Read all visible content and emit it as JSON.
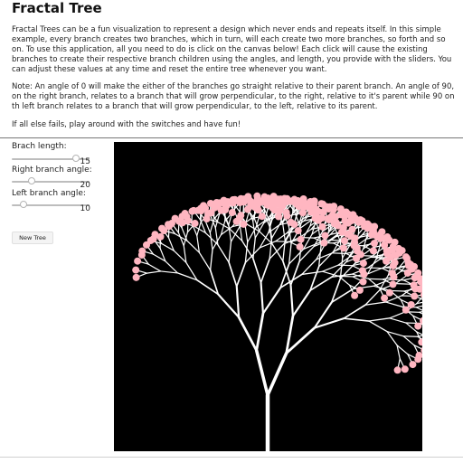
{
  "page": {
    "title": "Fractal Tree",
    "intro": "Fractal Trees can be a fun visualization to represent a design which never ends and repeats itself. In this simple example, every branch creates two branches, which in turn, will each create two more branches, so forth and so on. To use this application, all you need to do is click on the canvas below! Each click will cause the existing branches to create their respective branch children using the angles, and length, you provide with the sliders. You can adjust these values at any time and reset the entire tree whenever you want.",
    "note": "Note: An angle of 0 will make the either of the branches go straight relative to their parent branch. An angle of 90, on the right branch, relates to a branch that will grow perpendicular, to the right, relative to it's parent while 90 on th left branch relates to a branch that will grow perpendicular, to the left, relative to its parent.",
    "tip": "If all else fails, play around with the switches and have fun!"
  },
  "controls": {
    "branch_length": {
      "label": "Brach length:",
      "value": "15",
      "fraction": 0.86
    },
    "right_angle": {
      "label": "Right branch angle:",
      "value": "20",
      "fraction": 0.23
    },
    "left_angle": {
      "label": "Left branch angle:",
      "value": "10",
      "fraction": 0.11
    },
    "new_tree_label": "New Tree"
  },
  "canvas": {
    "background": "#000000",
    "branch_color": "#ffffff",
    "leaf_color": "#ffb6c1"
  }
}
